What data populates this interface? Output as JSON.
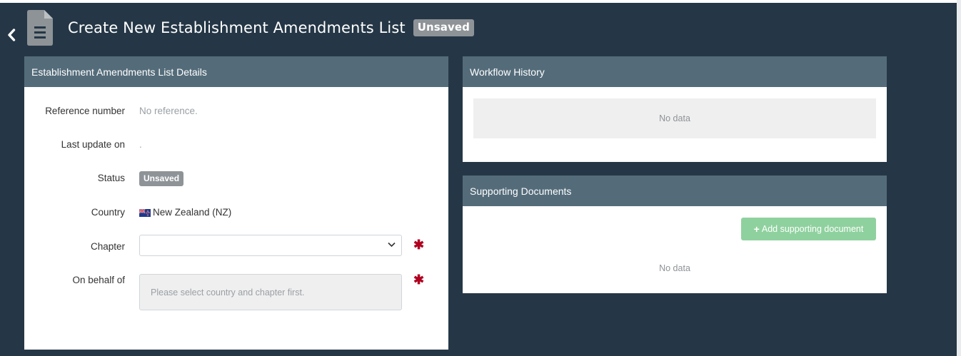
{
  "header": {
    "title": "Create New Establishment Amendments List",
    "status_badge": "Unsaved",
    "back_icon": "chevron-left-icon",
    "doc_icon": "document-icon"
  },
  "details_panel": {
    "title": "Establishment Amendments List Details",
    "fields": {
      "reference_number": {
        "label": "Reference number",
        "value": "No reference."
      },
      "last_update_on": {
        "label": "Last update on",
        "value": "."
      },
      "status": {
        "label": "Status",
        "value": "Unsaved"
      },
      "country": {
        "label": "Country",
        "value": "New Zealand (NZ)",
        "flag_icon": "new-zealand-flag-icon"
      },
      "chapter": {
        "label": "Chapter",
        "value": "",
        "required_mark": "✱"
      },
      "on_behalf_of": {
        "label": "On behalf of",
        "placeholder": "Please select country and chapter first.",
        "required_mark": "✱"
      }
    }
  },
  "workflow_panel": {
    "title": "Workflow History",
    "empty_text": "No data"
  },
  "documents_panel": {
    "title": "Supporting Documents",
    "add_button_label": "Add supporting document",
    "add_button_icon": "plus-icon",
    "empty_text": "No data"
  },
  "colors": {
    "background": "#253746",
    "panel_header": "#546c7a",
    "badge": "#8e9397",
    "add_button": "#8fd19e",
    "required": "#b00020"
  }
}
